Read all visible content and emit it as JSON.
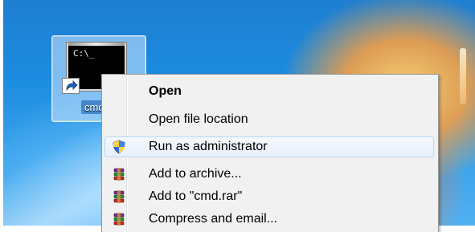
{
  "desktop": {
    "shortcut": {
      "label": "cmd",
      "console_prompt": "C:\\_"
    }
  },
  "context_menu": {
    "items": [
      {
        "label": "Open",
        "icon": "none",
        "bold": true
      },
      {
        "label": "Open file location",
        "icon": "none"
      },
      {
        "label": "Run as administrator",
        "icon": "uac-shield-icon",
        "highlighted": true
      },
      {
        "label": "Add to archive...",
        "icon": "winrar-icon"
      },
      {
        "label": "Add to \"cmd.rar\"",
        "icon": "winrar-icon"
      },
      {
        "label": "Compress and email...",
        "icon": "winrar-icon"
      }
    ]
  },
  "colors": {
    "menu_background": "#f1f1f1",
    "menu_border": "#979797",
    "highlight_border": "#b8d6fb",
    "highlight_fill": "#e8f0fa"
  }
}
